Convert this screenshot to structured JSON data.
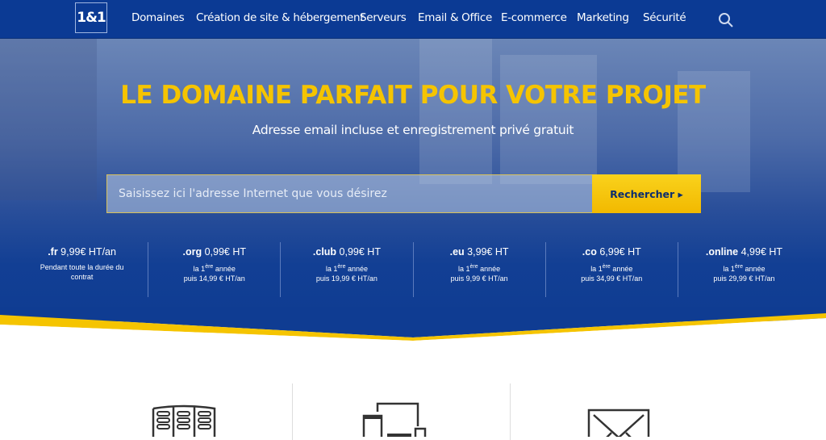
{
  "nav": {
    "logo": "1&1",
    "items": [
      "Domaines",
      "Création de site & hébergement",
      "Serveurs",
      "Email & Office",
      "E-commerce",
      "Marketing",
      "Sécurité"
    ],
    "search_icon": "search-icon"
  },
  "hero": {
    "title": "LE DOMAINE PARFAIT POUR VOTRE PROJET",
    "subtitle": "Adresse email incluse et enregistrement privé gratuit",
    "search": {
      "placeholder": "Saisissez ici l'adresse Internet que vous désirez",
      "value": "",
      "button": "Rechercher"
    }
  },
  "prices": [
    {
      "tld": ".fr",
      "price": "9,99€ HT/an",
      "note": "Pendant toute la durée du contrat"
    },
    {
      "tld": ".org",
      "price": "0,99€ HT",
      "first": "la 1",
      "sup": "ère",
      "first_end": " année",
      "then": "puis 14,99 € HT/an"
    },
    {
      "tld": ".club",
      "price": "0,99€ HT",
      "first": "la 1",
      "sup": "ère",
      "first_end": " année",
      "then": "puis 19,99 € HT/an"
    },
    {
      "tld": ".eu",
      "price": "3,99€ HT",
      "first": "la 1",
      "sup": "ère",
      "first_end": " année",
      "then": "puis 9,99 € HT/an"
    },
    {
      "tld": ".co",
      "price": "6,99€ HT",
      "first": "la 1",
      "sup": "ère",
      "first_end": " année",
      "then": "puis 34,99 € HT/an"
    },
    {
      "tld": ".online",
      "price": "4,99€ HT",
      "first": "la 1",
      "sup": "ère",
      "first_end": " année",
      "then": "puis 29,99 € HT/an"
    }
  ],
  "features": {
    "icons": [
      "server-icon",
      "devices-icon",
      "envelope-icon"
    ]
  },
  "colors": {
    "nav": "#0b3a94",
    "accent": "#f5c400",
    "button_text": "#0b2d6e"
  }
}
